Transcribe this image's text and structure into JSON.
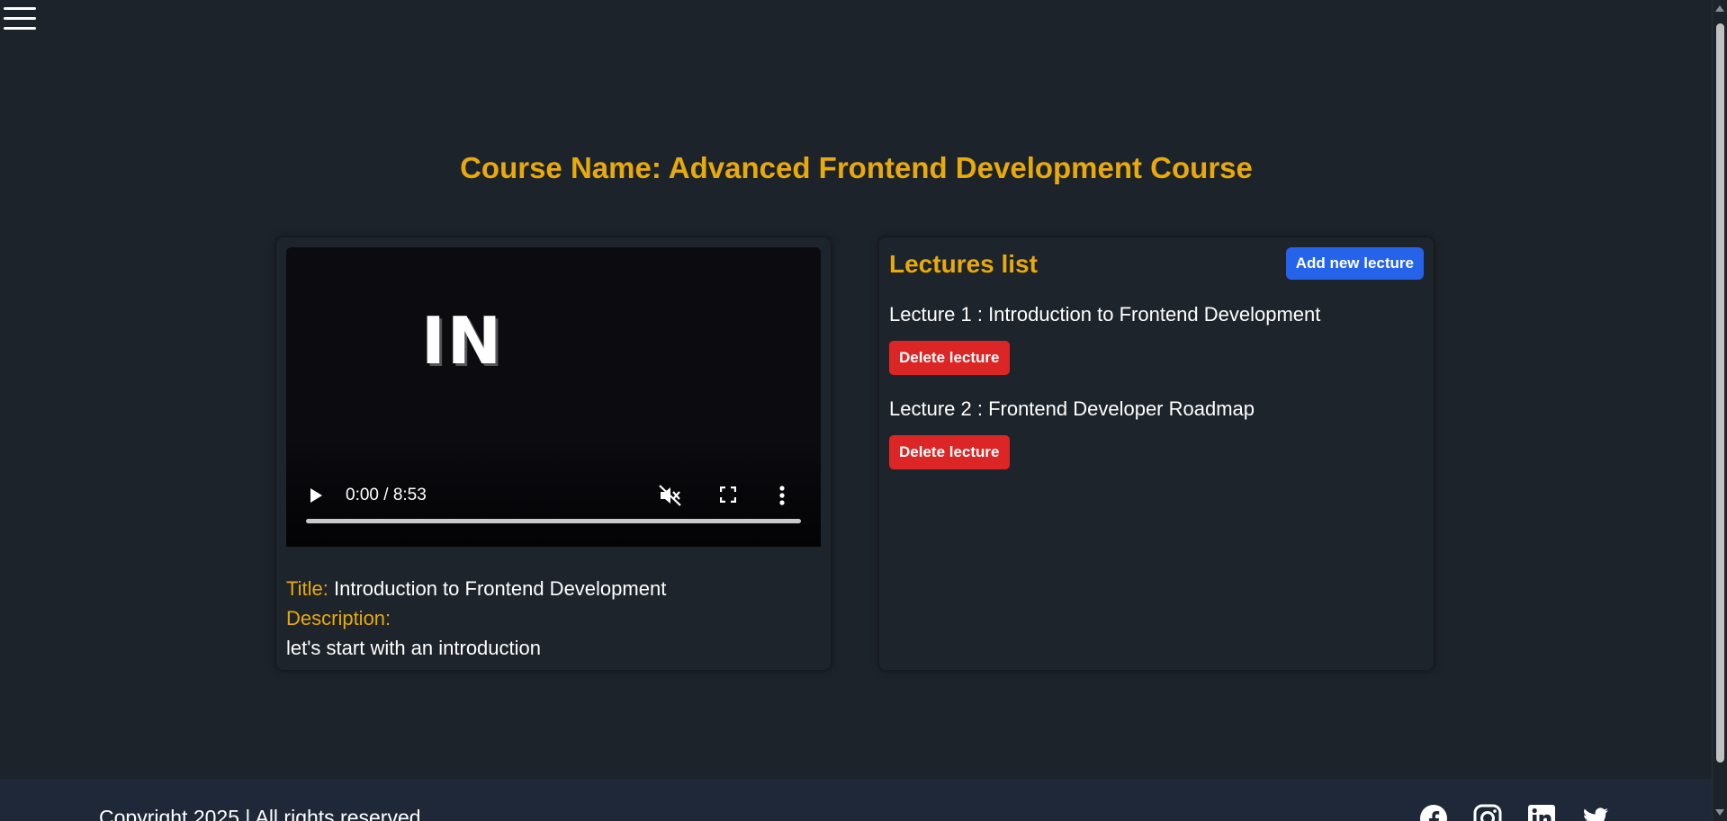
{
  "menu": {
    "icon": "hamburger-menu-icon"
  },
  "page": {
    "title": "Course Name: Advanced Frontend Development Course"
  },
  "video": {
    "frame_text": "IN",
    "current_time": "0:00 / 8:53",
    "muted": true,
    "controls": {
      "play_icon": "play-icon",
      "mute_icon": "muted-volume-icon",
      "fullscreen_icon": "fullscreen-icon",
      "more_icon": "more-options-icon"
    },
    "info": {
      "title_label": "Title:",
      "title_value": "Introduction to Frontend Development",
      "description_label": "Description:",
      "description_value": "let's start with an introduction"
    }
  },
  "lectures": {
    "header": "Lectures list",
    "add_button_label": "Add new lecture",
    "items": [
      {
        "label": "Lecture 1 : Introduction to Frontend Development",
        "delete_label": "Delete lecture"
      },
      {
        "label": "Lecture 2 : Frontend Developer Roadmap",
        "delete_label": "Delete lecture"
      }
    ]
  },
  "footer": {
    "copyright": "Copyright 2025 | All rights reserved",
    "social": [
      "facebook-icon",
      "instagram-icon",
      "linkedin-icon",
      "twitter-icon"
    ]
  },
  "colors": {
    "background": "#1d232a",
    "card": "#1e242b",
    "accent": "#e8a90c",
    "primary_button": "#2563eb",
    "danger_button": "#dc2626",
    "footer": "#1f2838"
  }
}
